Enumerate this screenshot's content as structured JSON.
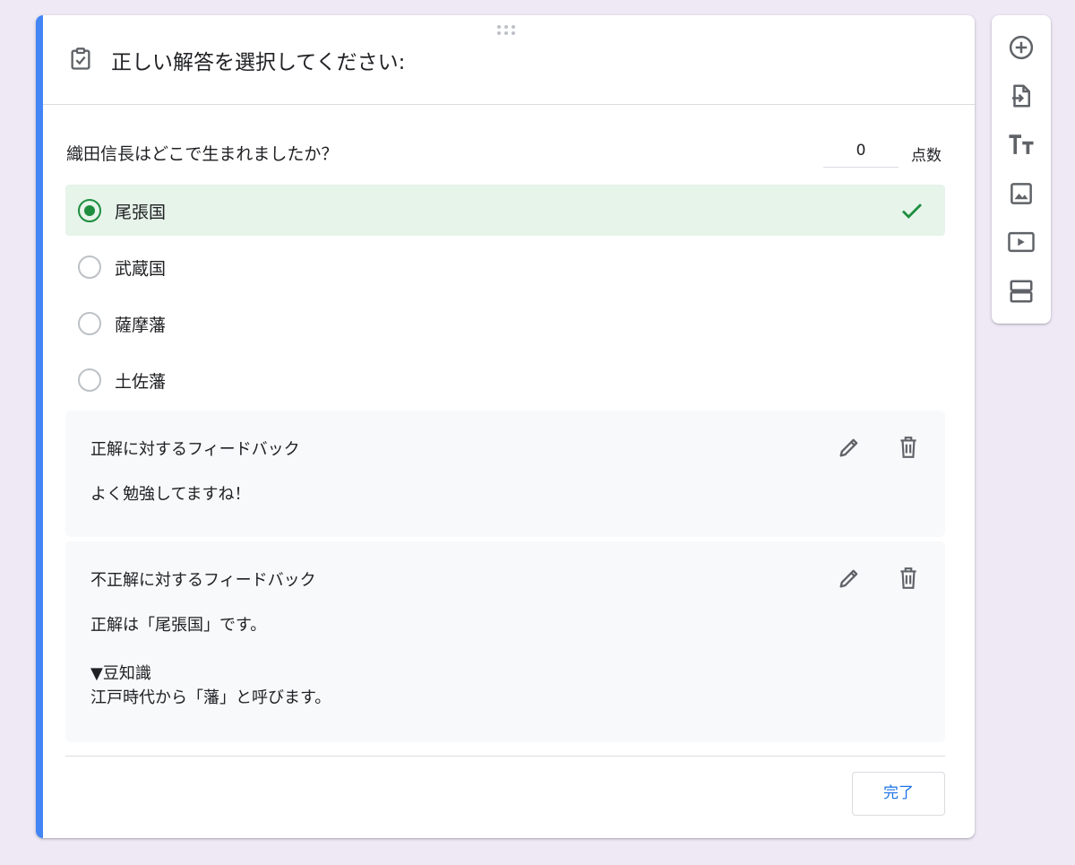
{
  "section": {
    "title": "正しい解答を選択してください:"
  },
  "question": {
    "text": "織田信長はどこで生まれましたか？",
    "points_value": "0",
    "points_label": "点数"
  },
  "options": [
    {
      "label": "尾張国",
      "correct": true
    },
    {
      "label": "武蔵国",
      "correct": false
    },
    {
      "label": "薩摩藩",
      "correct": false
    },
    {
      "label": "土佐藩",
      "correct": false
    }
  ],
  "feedback": {
    "correct": {
      "title": "正解に対するフィードバック",
      "text": "よく勉強してますね！"
    },
    "incorrect": {
      "title": "不正解に対するフィードバック",
      "text": "正解は「尾張国」です。\n\n▼豆知識\n江戸時代から「藩」と呼びます。"
    }
  },
  "footer": {
    "done_label": "完了"
  },
  "toolbar": {
    "icons": [
      "add-question-icon",
      "import-questions-icon",
      "add-title-icon",
      "add-image-icon",
      "add-video-icon",
      "add-section-icon"
    ]
  },
  "colors": {
    "accent": "#4285f4",
    "correct_green": "#1e8e3e",
    "correct_bg": "#e6f4ea",
    "link_blue": "#1a73e8",
    "page_bg": "#efe9f6"
  }
}
